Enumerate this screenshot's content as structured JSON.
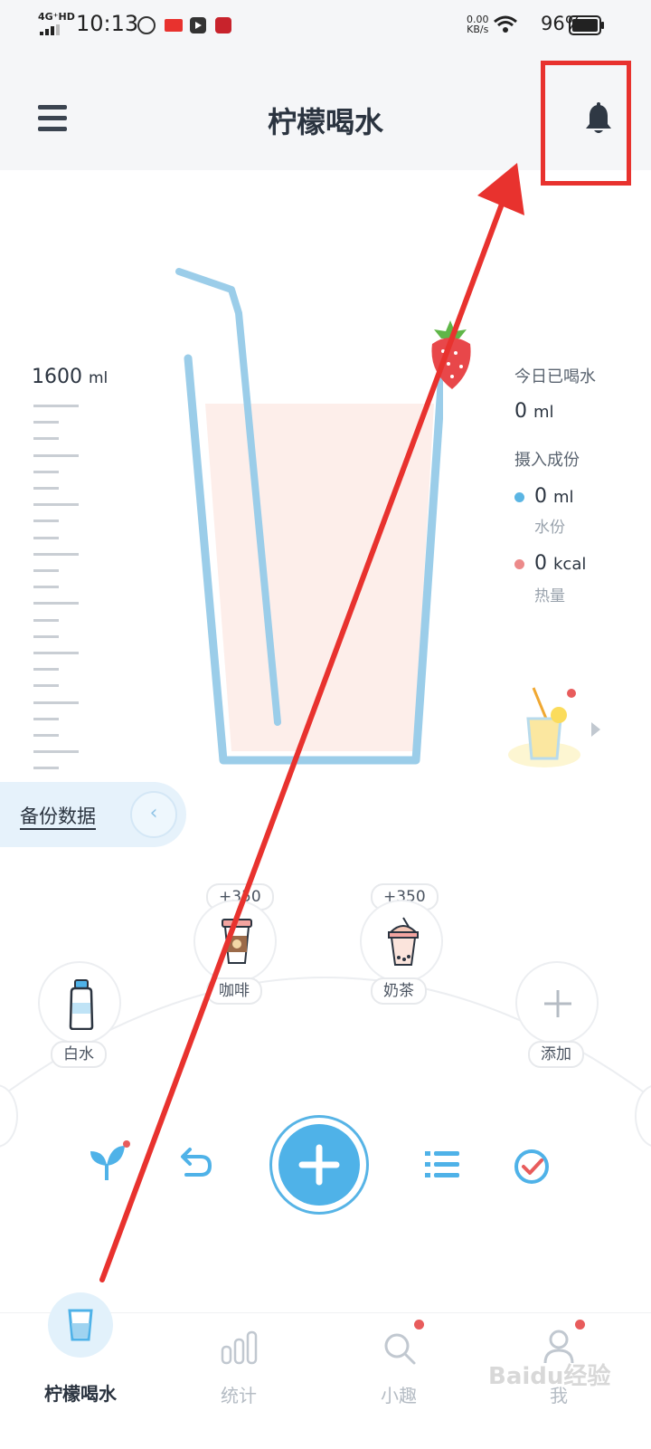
{
  "status_bar": {
    "network": "4G⁺HD",
    "time": "10:13",
    "rate_value": "0.00",
    "rate_unit": "KB/s",
    "battery": "96%"
  },
  "header": {
    "title": "柠檬喝水",
    "menu_icon": "menu-icon",
    "bell_icon": "bell-icon"
  },
  "scale": {
    "max_value": "1600",
    "unit": "ml"
  },
  "cup": {
    "fill_level": 0
  },
  "intake": {
    "today_label": "今日已喝水",
    "today_value": "0",
    "today_unit": "ml",
    "composition_label": "摄入成份",
    "water_value": "0",
    "water_unit": "ml",
    "water_label": "水份",
    "water_color": "#5bb5e3",
    "calorie_value": "0",
    "calorie_unit": "kcal",
    "calorie_label": "热量",
    "calorie_color": "#ec8a8a"
  },
  "backup": {
    "label": "备份数据"
  },
  "drinks": [
    {
      "name": "白水",
      "amount": "",
      "icon": "water-bottle-icon"
    },
    {
      "name": "咖啡",
      "amount": "+350",
      "icon": "coffee-cup-icon"
    },
    {
      "name": "奶茶",
      "amount": "+350",
      "icon": "milk-tea-icon"
    },
    {
      "name": "添加",
      "amount": "",
      "icon": "plus-icon"
    }
  ],
  "actions": [
    "sprout-icon",
    "undo-icon",
    "add-icon",
    "list-icon",
    "check-icon"
  ],
  "nav": [
    {
      "label": "柠檬喝水",
      "active": true
    },
    {
      "label": "统计",
      "active": false
    },
    {
      "label": "小趣",
      "active": false
    },
    {
      "label": "我",
      "active": false
    }
  ],
  "watermark": "Baidu经验",
  "colors": {
    "accent": "#4fb2e8",
    "annotation": "#e8322e",
    "cup_fill": "#fdeeea"
  }
}
